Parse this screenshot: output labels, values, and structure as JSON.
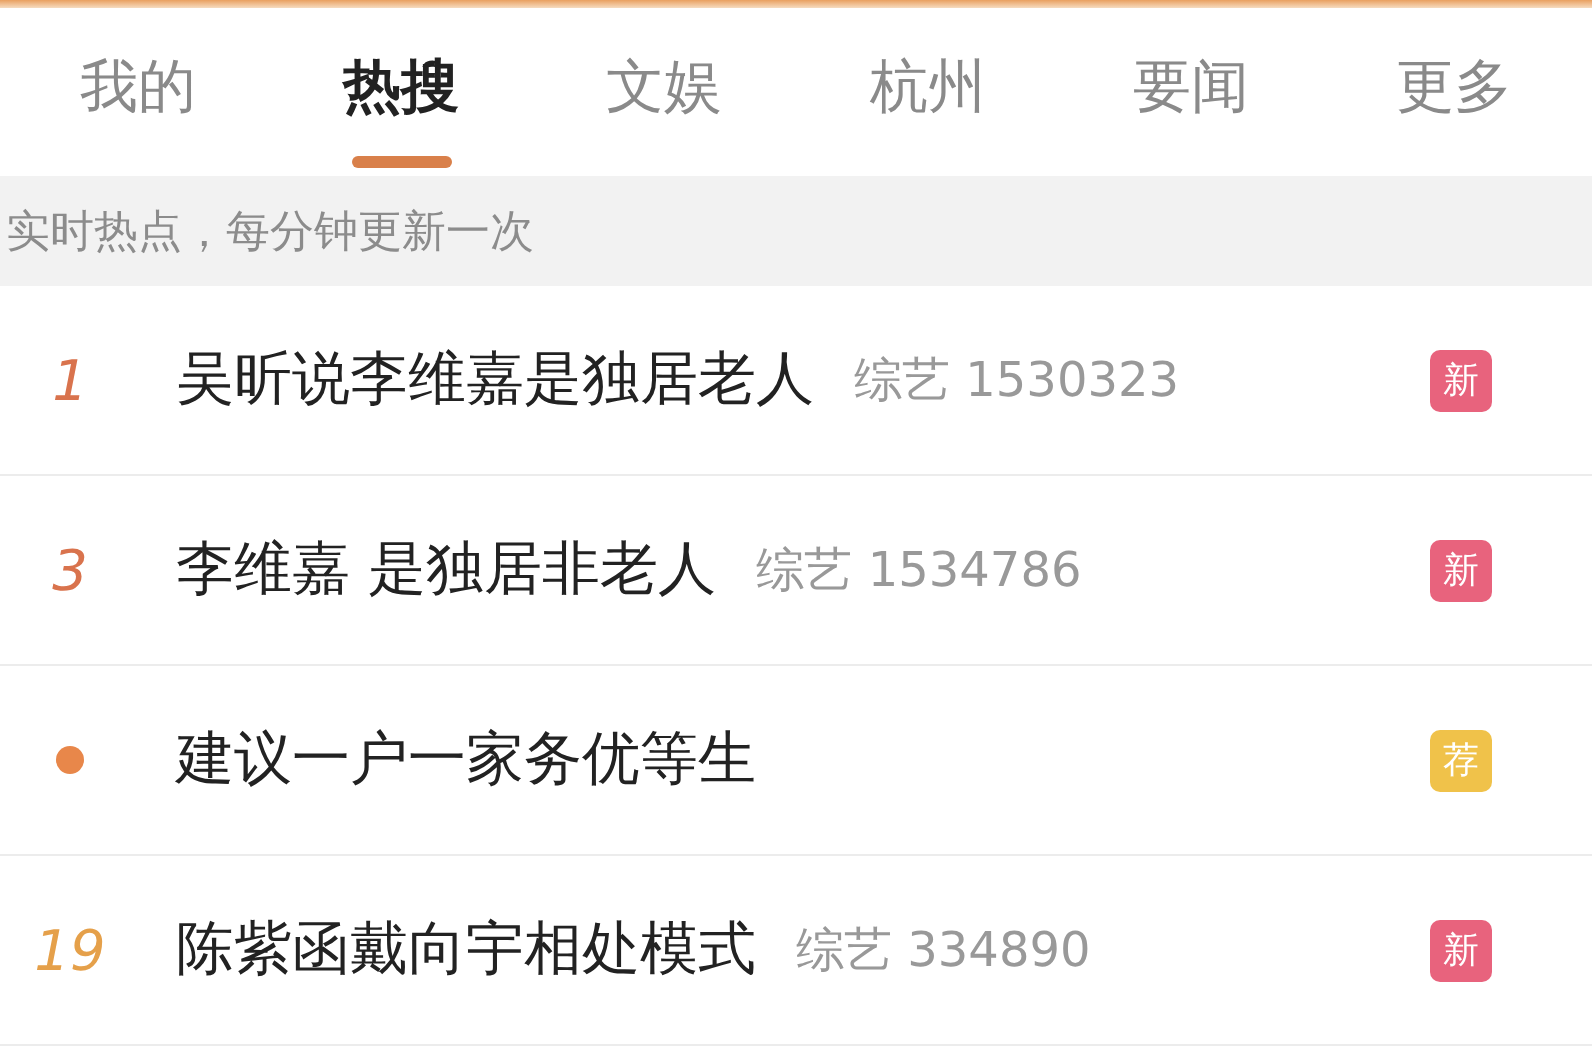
{
  "tabs": [
    {
      "label": "我的",
      "selected": false
    },
    {
      "label": "热搜",
      "selected": true
    },
    {
      "label": "文娱",
      "selected": false
    },
    {
      "label": "杭州",
      "selected": false
    },
    {
      "label": "要闻",
      "selected": false
    },
    {
      "label": "更多",
      "selected": false
    }
  ],
  "notice": "实时热点，每分钟更新一次",
  "rows": [
    {
      "kind": "number",
      "rank": "1",
      "color": "#d9734d",
      "title": "吴昕说李维嘉是独居老人",
      "meta": "综艺 1530323",
      "badge": {
        "label": "新",
        "color": "#e8637d"
      }
    },
    {
      "kind": "number",
      "rank": "3",
      "color": "#d9734d",
      "title": "李维嘉 是独居非老人",
      "meta": "综艺 1534786",
      "badge": {
        "label": "新",
        "color": "#e8637d"
      }
    },
    {
      "kind": "dot",
      "color": "#e8874a",
      "title": "建议一户一家务优等生",
      "badge": {
        "label": "荐",
        "color": "#f0c24a"
      }
    },
    {
      "kind": "number",
      "rank": "19",
      "color": "#e5a04a",
      "title": "陈紫函戴向宇相处模式",
      "meta": "综艺 334890",
      "badge": {
        "label": "新",
        "color": "#e8637d"
      }
    }
  ]
}
